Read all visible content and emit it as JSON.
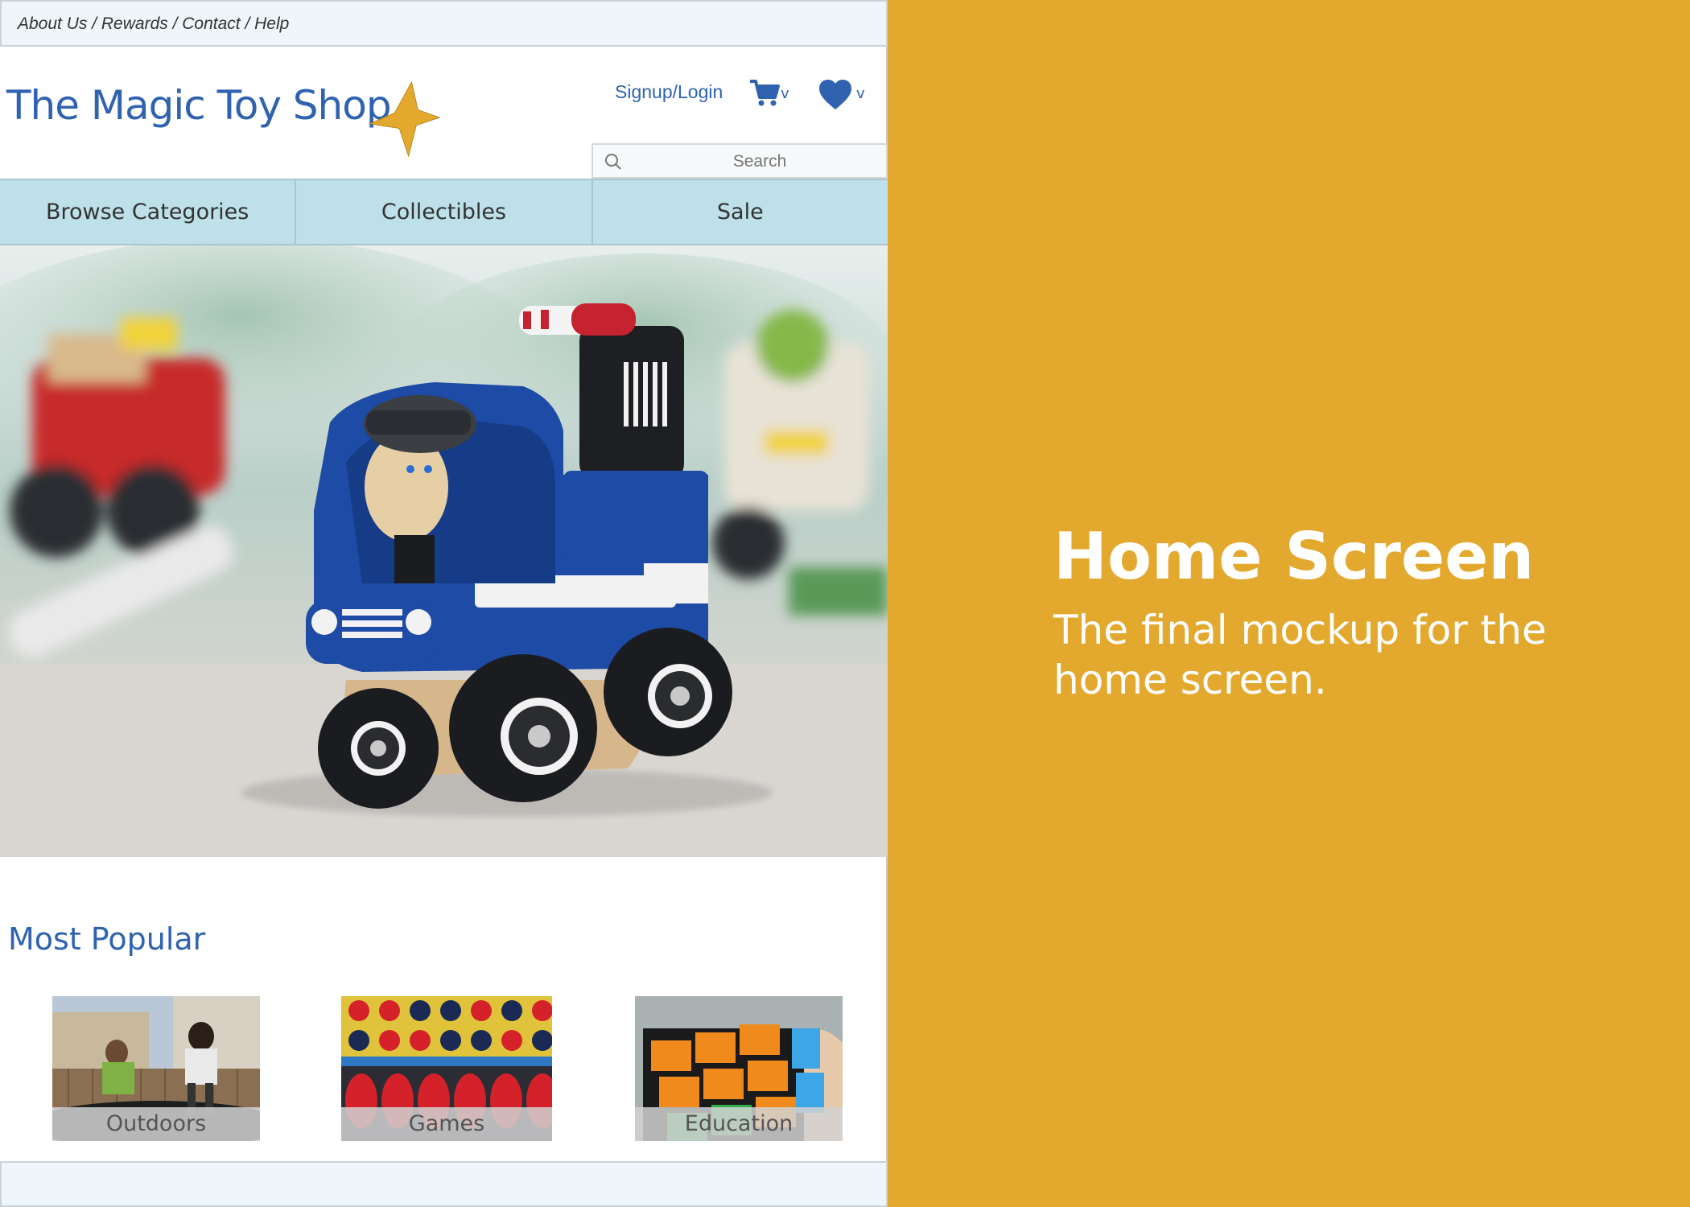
{
  "topbar": {
    "links": "About Us / Rewards / Contact / Help"
  },
  "header": {
    "logo": "The Magic Toy Shop",
    "signup": "Signup/Login",
    "cart_dropdown": "v",
    "wishlist_dropdown": "v",
    "search_placeholder": "Search"
  },
  "nav": {
    "items": [
      {
        "label": "Browse Categories"
      },
      {
        "label": "Collectibles"
      },
      {
        "label": "Sale"
      }
    ]
  },
  "popular": {
    "title": "Most Popular",
    "cards": [
      {
        "label": "Outdoors"
      },
      {
        "label": "Games"
      },
      {
        "label": "Education"
      }
    ]
  },
  "panel": {
    "title": "Home Screen",
    "subtitle": "The final mockup for the home screen."
  },
  "colors": {
    "brand_blue": "#2f63b0",
    "nav_bg": "#bde0e9",
    "panel_bg": "#e3a92f",
    "star": "#e3a92f"
  },
  "icons": {
    "cart": "cart-icon",
    "heart": "heart-icon",
    "search": "search-icon",
    "star": "star-icon"
  }
}
